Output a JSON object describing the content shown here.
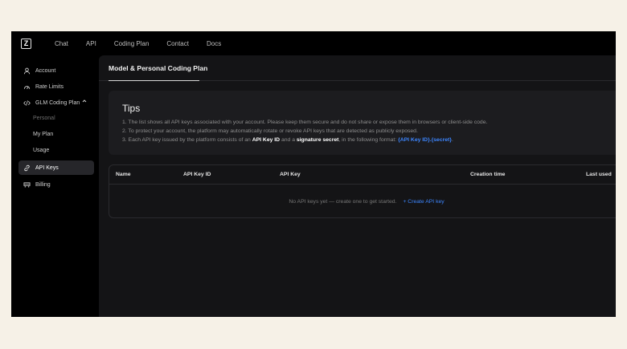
{
  "nav": {
    "logo_letter": "Z",
    "links": [
      "Chat",
      "API",
      "Coding Plan",
      "Contact",
      "Docs"
    ]
  },
  "sidebar": {
    "items": [
      {
        "label": "Account",
        "icon": "user-icon"
      },
      {
        "label": "Rate Limits",
        "icon": "gauge-icon"
      },
      {
        "label": "GLM Coding Plan",
        "icon": "code-icon"
      },
      {
        "label": "API Keys",
        "icon": "link-icon"
      },
      {
        "label": "Billing",
        "icon": "billing-icon"
      }
    ],
    "sub_items": [
      "Personal",
      "My Plan",
      "Usage"
    ]
  },
  "main": {
    "tab": "Model & Personal Coding Plan",
    "tips": {
      "title": "Tips",
      "line1": "1. The list shows all API keys associated with your account. Please keep them secure and do not share or expose them in browsers or client-side code.",
      "line2": "2. To protect your account, the platform may automatically rotate or revoke API keys that are detected as publicly exposed.",
      "line3_a": "3. Each API key issued by the platform consists of an ",
      "line3_b": "API Key ID",
      "line3_c": " and a ",
      "line3_d": "signature secret",
      "line3_e": ", in the following format: ",
      "line3_f": "{API Key ID}.{secret}",
      "line3_g": "."
    },
    "table": {
      "columns": [
        "Name",
        "API Key ID",
        "API Key",
        "Creation time",
        "Last used"
      ],
      "empty_text": "No API keys yet — create one to get started.",
      "create_label": "+ Create API key"
    }
  },
  "colors": {
    "accent": "#3d86ff",
    "background": "#000000",
    "panel": "#141416"
  }
}
